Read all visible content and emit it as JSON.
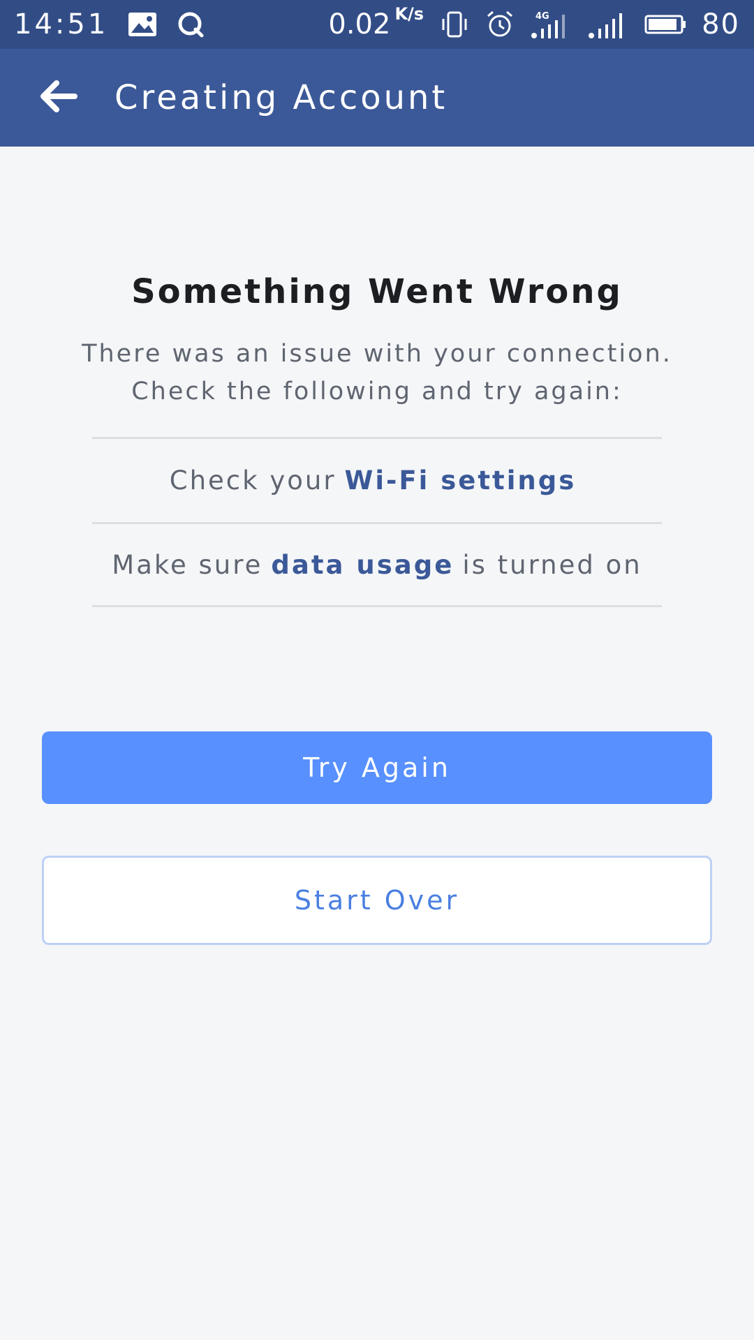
{
  "status_bar": {
    "time": "14:51",
    "network_speed": "0.02",
    "network_speed_unit": "K/s",
    "network_type": "4G",
    "battery_level": "80",
    "icons": [
      "image-notification-icon",
      "q-app-icon",
      "vibrate-icon",
      "alarm-icon",
      "signal-4g-icon",
      "signal-icon",
      "battery-icon"
    ]
  },
  "app_bar": {
    "title": "Creating Account",
    "back_icon": "arrow-left-icon"
  },
  "error": {
    "title": "Something Went Wrong",
    "message": "There was an issue with your connection. Check the following and try again:"
  },
  "checklist": [
    {
      "prefix": "Check your",
      "link": "Wi-Fi settings",
      "suffix": ""
    },
    {
      "prefix": "Make sure",
      "link": "data usage",
      "suffix": "is turned on"
    }
  ],
  "buttons": {
    "try_again": "Try Again",
    "start_over": "Start Over"
  },
  "colors": {
    "status_bar": "#324d86",
    "app_bar": "#3b5998",
    "primary_button": "#5890ff",
    "link": "#3b5998",
    "background": "#f5f6f8"
  }
}
